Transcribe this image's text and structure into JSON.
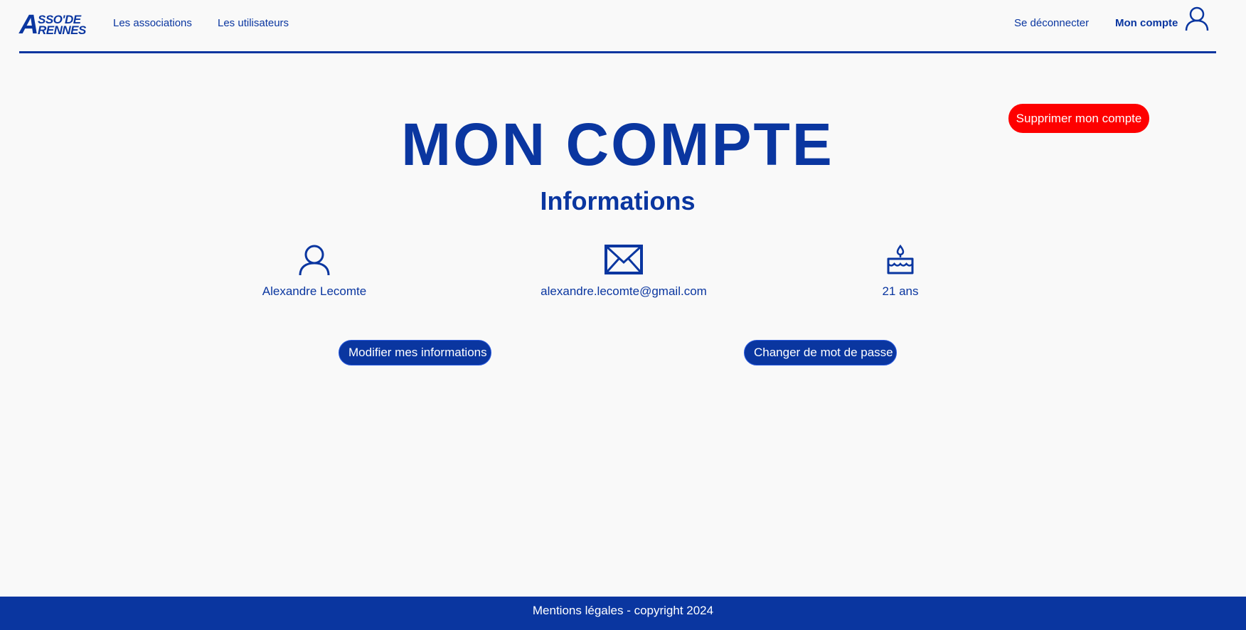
{
  "header": {
    "logo": {
      "letter": "A",
      "line1": "SSO'DE",
      "line2": "RENNES"
    },
    "nav": {
      "associations": "Les associations",
      "users": "Les utilisateurs",
      "logout": "Se déconnecter",
      "account": "Mon compte"
    },
    "account_icon": "user-icon"
  },
  "main": {
    "delete_button": "Supprimer mon compte",
    "title": "MON COMPTE",
    "section_title": "Informations",
    "info": {
      "name": "Alexandre Lecomte",
      "name_icon": "user-icon",
      "email": "alexandre.lecomte@gmail.com",
      "email_icon": "envelope-icon",
      "age": "21 ans",
      "age_icon": "birthday-cake-icon"
    },
    "modify_button": "Modifier mes informations",
    "password_button": "Changer de mot de passe"
  },
  "footer": {
    "text": "Mentions légales - copyright 2024"
  },
  "colors": {
    "primary": "#0a36a0",
    "danger": "#fe0000",
    "background": "#f9f9f9"
  }
}
